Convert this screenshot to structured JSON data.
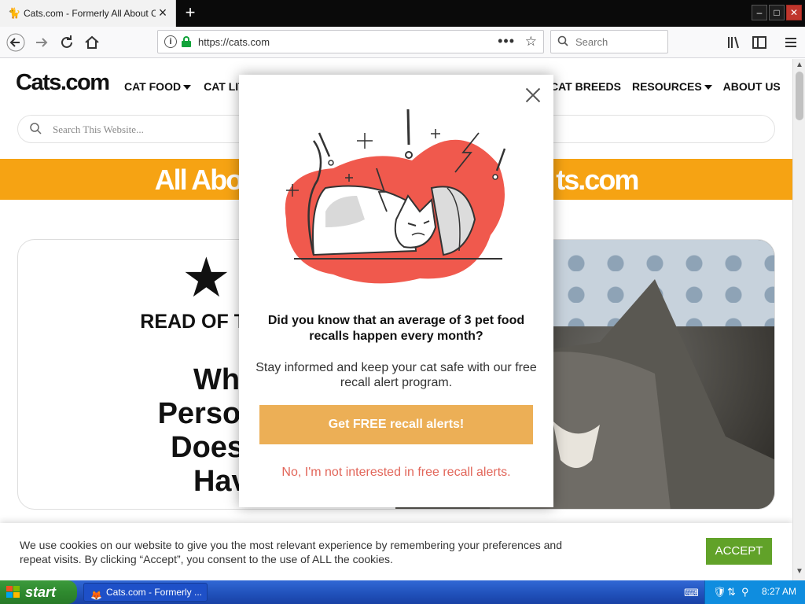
{
  "browser": {
    "tab_title": "Cats.com - Formerly All About Cats",
    "url": "https://cats.com",
    "search_placeholder": "Search",
    "window_buttons": {
      "minimize": "–",
      "maximize": "□",
      "close": "✕"
    },
    "icons": {
      "back": "back-arrow-icon",
      "forward": "forward-arrow-icon",
      "reload": "reload-icon",
      "home": "home-icon",
      "library": "library-icon",
      "sidebar": "sidebar-icon",
      "menu": "hamburger-menu-icon"
    }
  },
  "site": {
    "logo": "Cats.com",
    "nav_left": [
      "CAT FOOD",
      "CAT LIT"
    ],
    "nav_right": [
      "CAT BREEDS",
      "RESOURCES",
      "ABOUT US"
    ],
    "search_placeholder": "Search This Website...",
    "banner_left": "All Abo",
    "banner_right": "ts.com",
    "card": {
      "kicker": "READ OF THE",
      "headline_lines": [
        "Which",
        "Personality",
        "Does You",
        "Have?"
      ]
    }
  },
  "modal": {
    "question": "Did you know that an average of 3 pet food recalls happen every month?",
    "description": "Stay informed and keep your cat safe with our free recall alert program.",
    "cta": "Get FREE recall alerts!",
    "decline": "No, I'm not interested in free recall alerts."
  },
  "cookie": {
    "message": "We use cookies on our website to give you the most relevant experience by remembering your preferences and repeat visits. By clicking “Accept”, you consent to the use of ALL the cookies.",
    "accept": "ACCEPT"
  },
  "taskbar": {
    "start": "start",
    "task": "Cats.com - Formerly ...",
    "clock": "8:27 AM"
  },
  "colors": {
    "banner": "#f6a313",
    "cta": "#ecaf56",
    "decline": "#e2665a",
    "accept": "#61a229",
    "illustration_blob": "#f0594d"
  }
}
